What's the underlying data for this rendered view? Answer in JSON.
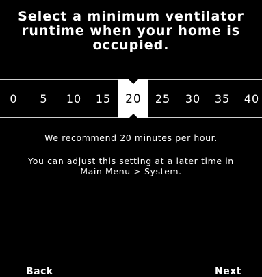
{
  "title": "Select a minimum ventilator\nruntime when your home is\noccupied.",
  "picker": {
    "options": [
      "0",
      "5",
      "10",
      "15",
      "20",
      "25",
      "30",
      "35",
      "40"
    ],
    "selected": "20"
  },
  "message": {
    "recommend": "We recommend 20 minutes per hour.",
    "adjust": "You can adjust this setting at a later time in\nMain Menu > System."
  },
  "nav": {
    "back_label": "Back",
    "next_label": "Next"
  }
}
